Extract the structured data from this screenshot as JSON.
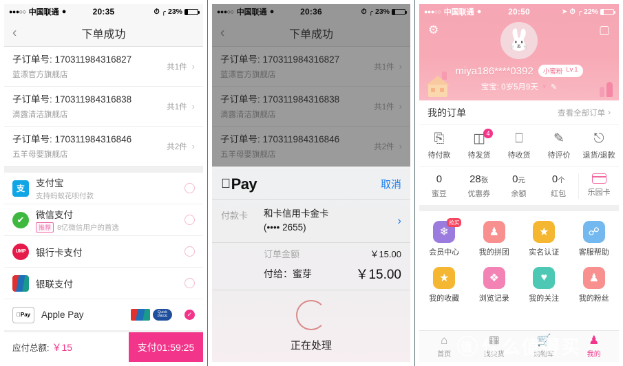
{
  "panel1": {
    "status": {
      "dots": "●●●○○",
      "carrier": "中国联通",
      "wifi": "WiFi",
      "time": "20:35",
      "alarm": "alarm-icon",
      "bluetooth": "bluetooth-icon",
      "battery": "23%"
    },
    "nav": {
      "back": "‹",
      "title": "下单成功"
    },
    "orders": [
      {
        "label": "子订单号: 170311984316827",
        "shop": "蓝漂官方旗舰店",
        "count": "共1件"
      },
      {
        "label": "子订单号: 170311984316838",
        "shop": "滴露清洁旗舰店",
        "count": "共1件"
      },
      {
        "label": "子订单号: 170311984316846",
        "shop": "五羊母婴旗舰店",
        "count": "共2件"
      }
    ],
    "payments": [
      {
        "name": "支付宝",
        "sub": "支持蚂蚁花呗付款",
        "tag": "",
        "icon": "alipay-icon",
        "iconText": "支",
        "selected": false
      },
      {
        "name": "微信支付",
        "sub": "8亿微信用户的首选",
        "tag": "推荐",
        "icon": "wechat-icon",
        "iconText": "✔",
        "selected": false
      },
      {
        "name": "银行卡支付",
        "sub": "",
        "tag": "",
        "icon": "unionpay-icon",
        "iconText": "UMP",
        "selected": false
      },
      {
        "name": "银联支付",
        "sub": "",
        "tag": "",
        "icon": "yinlian-icon",
        "iconText": "银联",
        "selected": false
      },
      {
        "name": "Apple Pay",
        "sub": "",
        "tag": "",
        "icon": "applepay-icon",
        "iconText": "Pay",
        "selected": true
      }
    ],
    "footer": {
      "totalLabel": "应付总额:",
      "totalValue": "￥15",
      "button": "支付01:59:25"
    }
  },
  "panel2": {
    "status": {
      "dots": "●●●○○",
      "carrier": "中国联通",
      "wifi": "WiFi",
      "time": "20:36",
      "alarm": "alarm-icon",
      "bluetooth": "bluetooth-icon",
      "battery": "23%"
    },
    "nav": {
      "back": "‹",
      "title": "下单成功"
    },
    "orders": [
      {
        "label": "子订单号: 170311984316827",
        "shop": "蓝漂官方旗舰店",
        "count": "共1件"
      },
      {
        "label": "子订单号: 170311984316838",
        "shop": "滴露清洁旗舰店",
        "count": "共1件"
      },
      {
        "label": "子订单号: 170311984316846",
        "shop": "五羊母婴旗舰店",
        "count": "共2件"
      }
    ],
    "sheet": {
      "logo": "Pay",
      "appleGlyph": "",
      "cancel": "取消",
      "cardLabel": "付款卡",
      "cardName": "和卡信用卡金卡",
      "cardNumber": "(•••• 2655)",
      "cardArrow": "›",
      "amountLabel": "订单金额",
      "amountValue": "￥15.00",
      "payToLabel": "付给：蜜芽",
      "payToValue": "￥15.00",
      "processing": "正在处理"
    }
  },
  "panel3": {
    "status": {
      "dots": "●●●○○",
      "carrier": "中国联通",
      "wifi": "WiFi",
      "time": "20:50",
      "location": "location-icon",
      "alarm": "alarm-icon",
      "bluetooth": "bluetooth-icon",
      "battery": "22%"
    },
    "header": {
      "gear": "settings-icon",
      "message": "message-icon",
      "avatar": "rabbit-avatar",
      "username": "miya186****0392",
      "levelName": "小蜜粉",
      "levelValue": "Lv.1",
      "babyInfo": "宝宝: 0岁5月9天",
      "genderSymbol": "♀",
      "editIcon": "✎"
    },
    "ordersSection": {
      "title": "我的订单",
      "more": "查看全部订单",
      "moreArrow": "›"
    },
    "orderStates": [
      {
        "label": "待付款",
        "icon": "wallet-icon",
        "glyph": "▱",
        "badge": ""
      },
      {
        "label": "待发货",
        "icon": "box-icon",
        "glyph": "▤",
        "badge": "4"
      },
      {
        "label": "待收货",
        "icon": "truck-icon",
        "glyph": "🚚",
        "badge": ""
      },
      {
        "label": "待评价",
        "icon": "edit-icon",
        "glyph": "✎",
        "badge": ""
      },
      {
        "label": "退货/退款",
        "icon": "refund-icon",
        "glyph": "¥",
        "badge": ""
      }
    ],
    "assets": [
      {
        "value": "0",
        "unit": "",
        "label": "蜜豆"
      },
      {
        "value": "28",
        "unit": "张",
        "label": "优惠券"
      },
      {
        "value": "0",
        "unit": "元",
        "label": "余额"
      },
      {
        "value": "0",
        "unit": "个",
        "label": "红包"
      },
      {
        "value": "",
        "unit": "",
        "label": "乐园卡"
      }
    ],
    "gridRow1": [
      {
        "label": "会员中心",
        "color": "#9b7bdd",
        "glyph": "✿",
        "badge": "抢买"
      },
      {
        "label": "我的拼团",
        "color": "#f7908f",
        "glyph": "👥",
        "badge": ""
      },
      {
        "label": "实名认证",
        "color": "#f5b731",
        "glyph": "🛡",
        "badge": ""
      },
      {
        "label": "客服帮助",
        "color": "#73b8ee",
        "glyph": "🎧",
        "badge": ""
      }
    ],
    "gridRow2": [
      {
        "label": "我的收藏",
        "color": "#f5b731",
        "glyph": "★",
        "badge": ""
      },
      {
        "label": "浏览记录",
        "color": "#f383b4",
        "glyph": "👣",
        "badge": ""
      },
      {
        "label": "我的关注",
        "color": "#4cc8b4",
        "glyph": "♥",
        "badge": ""
      },
      {
        "label": "我的粉丝",
        "color": "#f7908f",
        "glyph": "👤",
        "badge": ""
      }
    ],
    "tabs": [
      {
        "label": "首页",
        "glyph": "⌂",
        "active": false
      },
      {
        "label": "找尖货",
        "glyph": "▦",
        "active": false
      },
      {
        "label": "购物车",
        "glyph": "🛒",
        "active": false
      },
      {
        "label": "我的",
        "glyph": "👤",
        "active": true
      }
    ],
    "watermark": {
      "logo": "值",
      "text": "什么值得买"
    }
  },
  "colors": {
    "brandPink": "#f2348a",
    "headerPink": "#f6a6b4",
    "blue": "#1a7ef0"
  }
}
